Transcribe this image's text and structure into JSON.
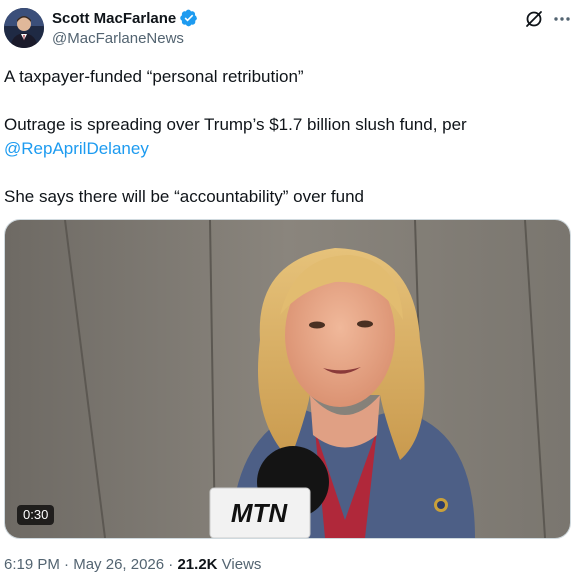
{
  "author": {
    "display_name": "Scott MacFarlane",
    "handle": "@MacFarlaneNews",
    "verified": true
  },
  "tweet": {
    "line1": "A taxpayer-funded “personal retribution”",
    "line2": "Outrage is spreading over Trump’s $1.7 billion slush fund, per",
    "mention": "@RepAprilDelaney",
    "line4": "She says there will be “accountability” over fund"
  },
  "media": {
    "duration": "0:30",
    "mic_brand": "MTN"
  },
  "meta": {
    "time": "6:19 PM",
    "separator": "·",
    "date": "May 26, 2026",
    "views_count": "21.2K",
    "views_label": "Views"
  },
  "colors": {
    "link": "#1d9bf0",
    "verified": "#1d9bf0",
    "secondary_text": "#536471"
  },
  "icons": {
    "verified": "verified-badge-icon",
    "grok": "grok-icon",
    "more": "more-icon",
    "avatar": "avatar"
  }
}
